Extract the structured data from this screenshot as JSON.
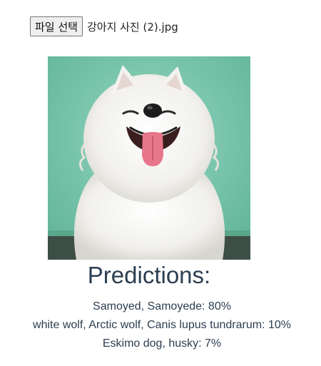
{
  "file_input": {
    "button_label": "파일 선택",
    "file_name": "강아지 사진 (2).jpg"
  },
  "image": {
    "subject": "samoyed-dog-photo"
  },
  "predictions": {
    "title": "Predictions:",
    "items": [
      {
        "text": "Samoyed, Samoyede: 80%"
      },
      {
        "text": "white wolf, Arctic wolf, Canis lupus tundrarum: 10%"
      },
      {
        "text": "Eskimo dog, husky: 7%"
      }
    ]
  },
  "colors": {
    "background_teal": "#7fc9b1",
    "title_text": "#2c3e50"
  }
}
